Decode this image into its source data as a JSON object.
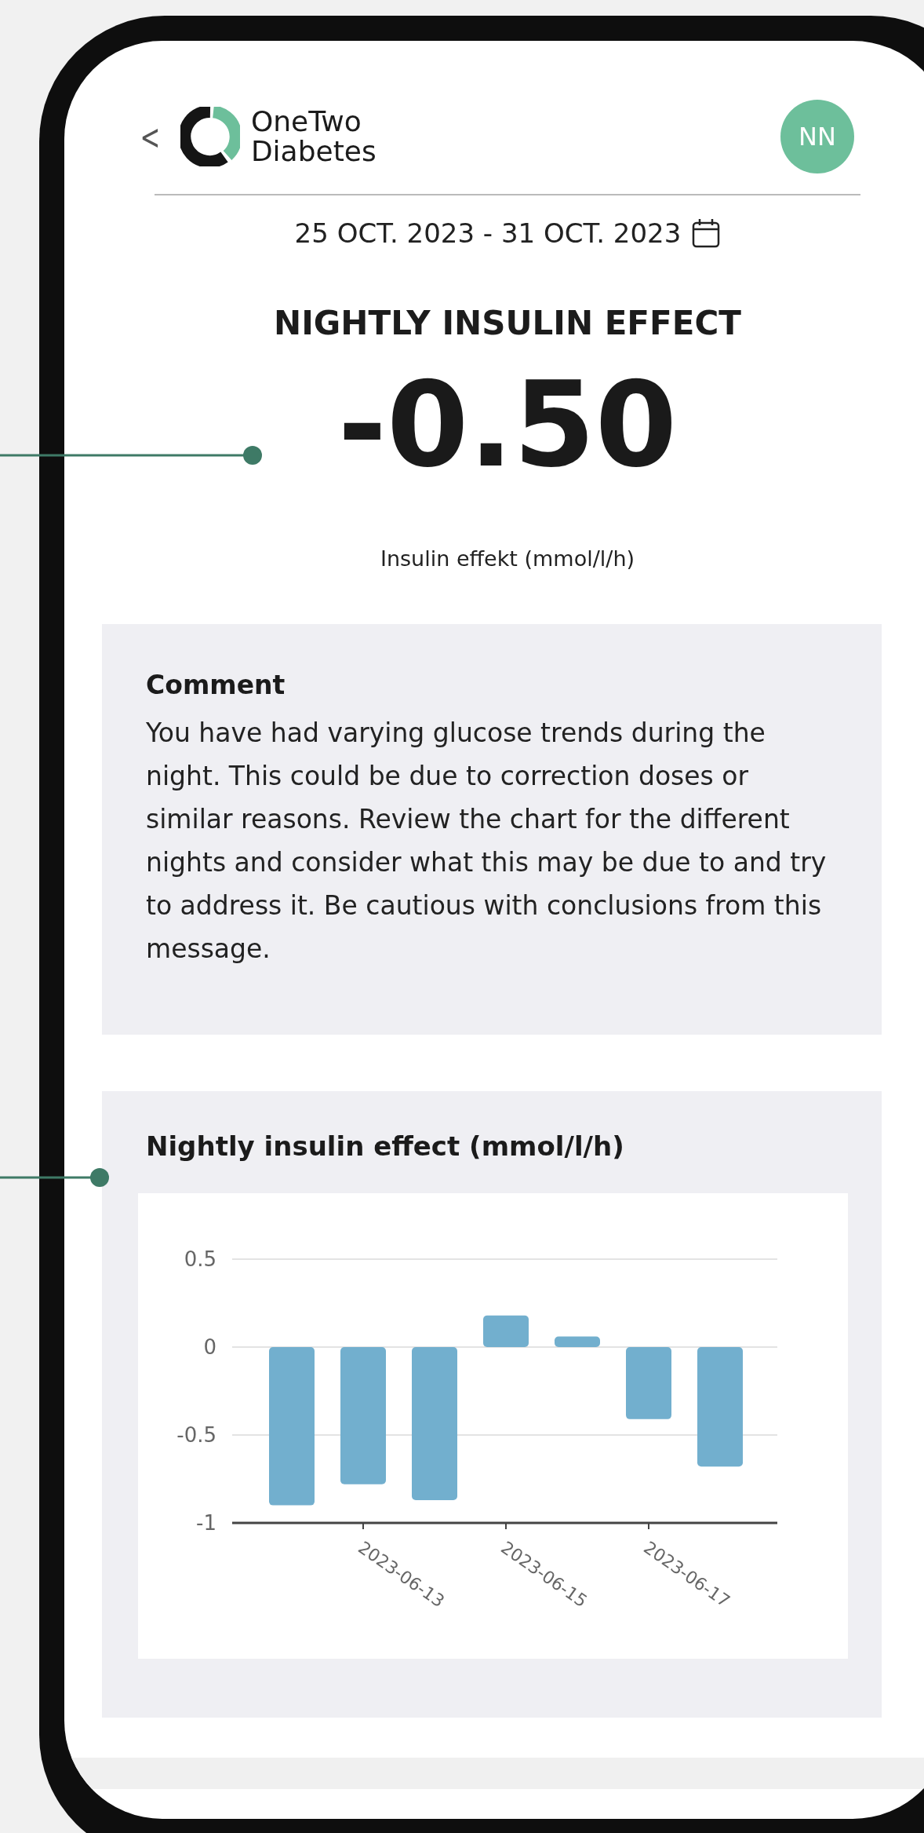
{
  "header": {
    "back": "<",
    "brand": [
      "OneTwo",
      "Diabetes"
    ],
    "avatar": "NN"
  },
  "date_range": "25 OCT. 2023 - 31 OCT. 2023",
  "title": "NIGHTLY INSULIN EFFECT",
  "value": "-0.50",
  "unit": "Insulin effekt (mmol/l/h)",
  "comment": {
    "title": "Comment",
    "text": "You have had varying glucose trends during the night. This could be due to correction doses or similar reasons. Review the chart for the different nights and consider what this may be due to and try to address it. Be cautious with conclusions from this message."
  },
  "chart_card": {
    "title": "Nightly insulin effect (mmol/l/h)",
    "chart_data": {
      "type": "bar",
      "categories": [
        null,
        "2023-06-13",
        null,
        "2023-06-15",
        null,
        "2023-06-17",
        null
      ],
      "series": [
        {
          "color": "#72afce",
          "values": [
            -0.9,
            -0.78,
            -0.87,
            0.18,
            0.06,
            -0.41,
            -0.68
          ]
        }
      ],
      "ylim": [
        -1,
        0.5
      ],
      "yticks": [
        -1,
        -0.5,
        0,
        0.5
      ]
    }
  }
}
